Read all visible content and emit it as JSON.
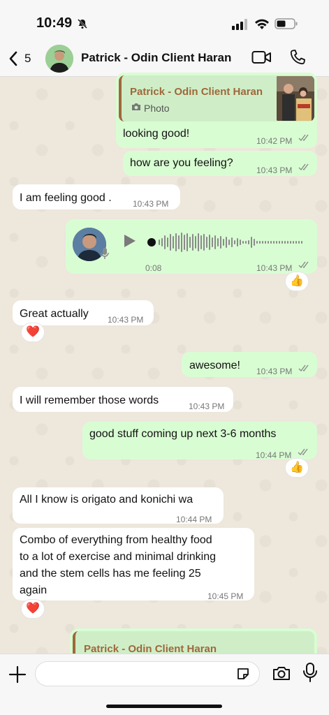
{
  "status_bar": {
    "time": "10:49"
  },
  "header": {
    "back_count": "5",
    "contact_name": "Patrick - Odin Client Haran"
  },
  "messages": [
    {
      "quote_name": "Patrick - Odin Client Haran",
      "quote_type": "Photo",
      "text": "looking good!",
      "time": "10:42 PM"
    },
    {
      "text": "how are you feeling?",
      "time": "10:43 PM"
    },
    {
      "text": "I am feeling good .",
      "time": "10:43 PM"
    },
    {
      "voice_duration": "0:08",
      "time": "10:43 PM",
      "reaction": "👍"
    },
    {
      "text": "Great actually",
      "time": "10:43 PM",
      "reaction": "❤️"
    },
    {
      "text": "awesome!",
      "time": "10:43 PM"
    },
    {
      "text": "I will remember those words",
      "time": "10:43 PM"
    },
    {
      "text": "good stuff coming up next 3-6 months",
      "time": "10:44 PM",
      "reaction": "👍"
    },
    {
      "text": "All I know is origato and konichi wa",
      "time": "10:44 PM"
    },
    {
      "lines": [
        "Combo of everything from healthy food",
        "to a lot of exercise and minimal drinking",
        "and the stem cells has me feeling 25",
        "again"
      ],
      "time": "10:45 PM",
      "reaction": "❤️"
    },
    {
      "quote_name": "Patrick - Odin Client Haran"
    }
  ],
  "composer": {
    "placeholder": ""
  },
  "colors": {
    "outgoing": "#d9fdd3",
    "incoming": "#ffffff",
    "quote_name": "#a0673c",
    "ticks": "#8a8a8a"
  }
}
